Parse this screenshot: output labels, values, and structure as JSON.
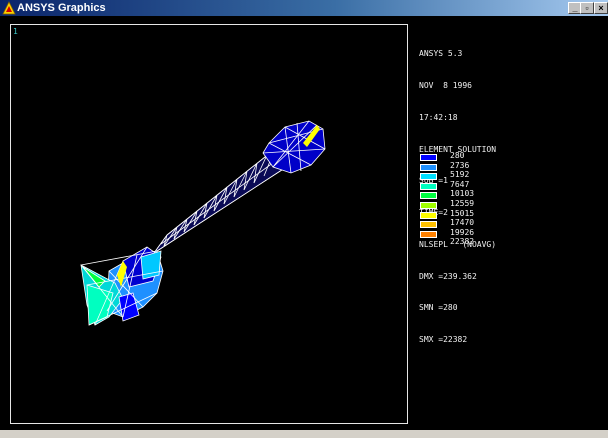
{
  "window": {
    "title": "ANSYS Graphics",
    "controls": {
      "minimize": "_",
      "maximize": "▫",
      "close": "×"
    }
  },
  "viewport": {
    "window_number": "1"
  },
  "info": {
    "lines": [
      "ANSYS 5.3",
      "NOV  8 1996",
      "17:42:18",
      "ELEMENT SOLUTION",
      "SUB =1",
      "TIME=2",
      "NLSEPL   (NOAVG)",
      "DMX =239.362",
      "SMN =280",
      "SMX =22382"
    ]
  },
  "legend": {
    "entries": [
      {
        "value": "280",
        "color": "#0000ff"
      },
      {
        "value": "2736",
        "color": "#1e90ff"
      },
      {
        "value": "5192",
        "color": "#00e0ff"
      },
      {
        "value": "7647",
        "color": "#00ffc0"
      },
      {
        "value": "10103",
        "color": "#00ff40"
      },
      {
        "value": "12559",
        "color": "#a0ff00"
      },
      {
        "value": "15015",
        "color": "#ffff00"
      },
      {
        "value": "17470",
        "color": "#ffc000"
      },
      {
        "value": "19926",
        "color": "#ff8000"
      },
      {
        "value": "22382",
        "color": "#ff0000"
      }
    ]
  }
}
